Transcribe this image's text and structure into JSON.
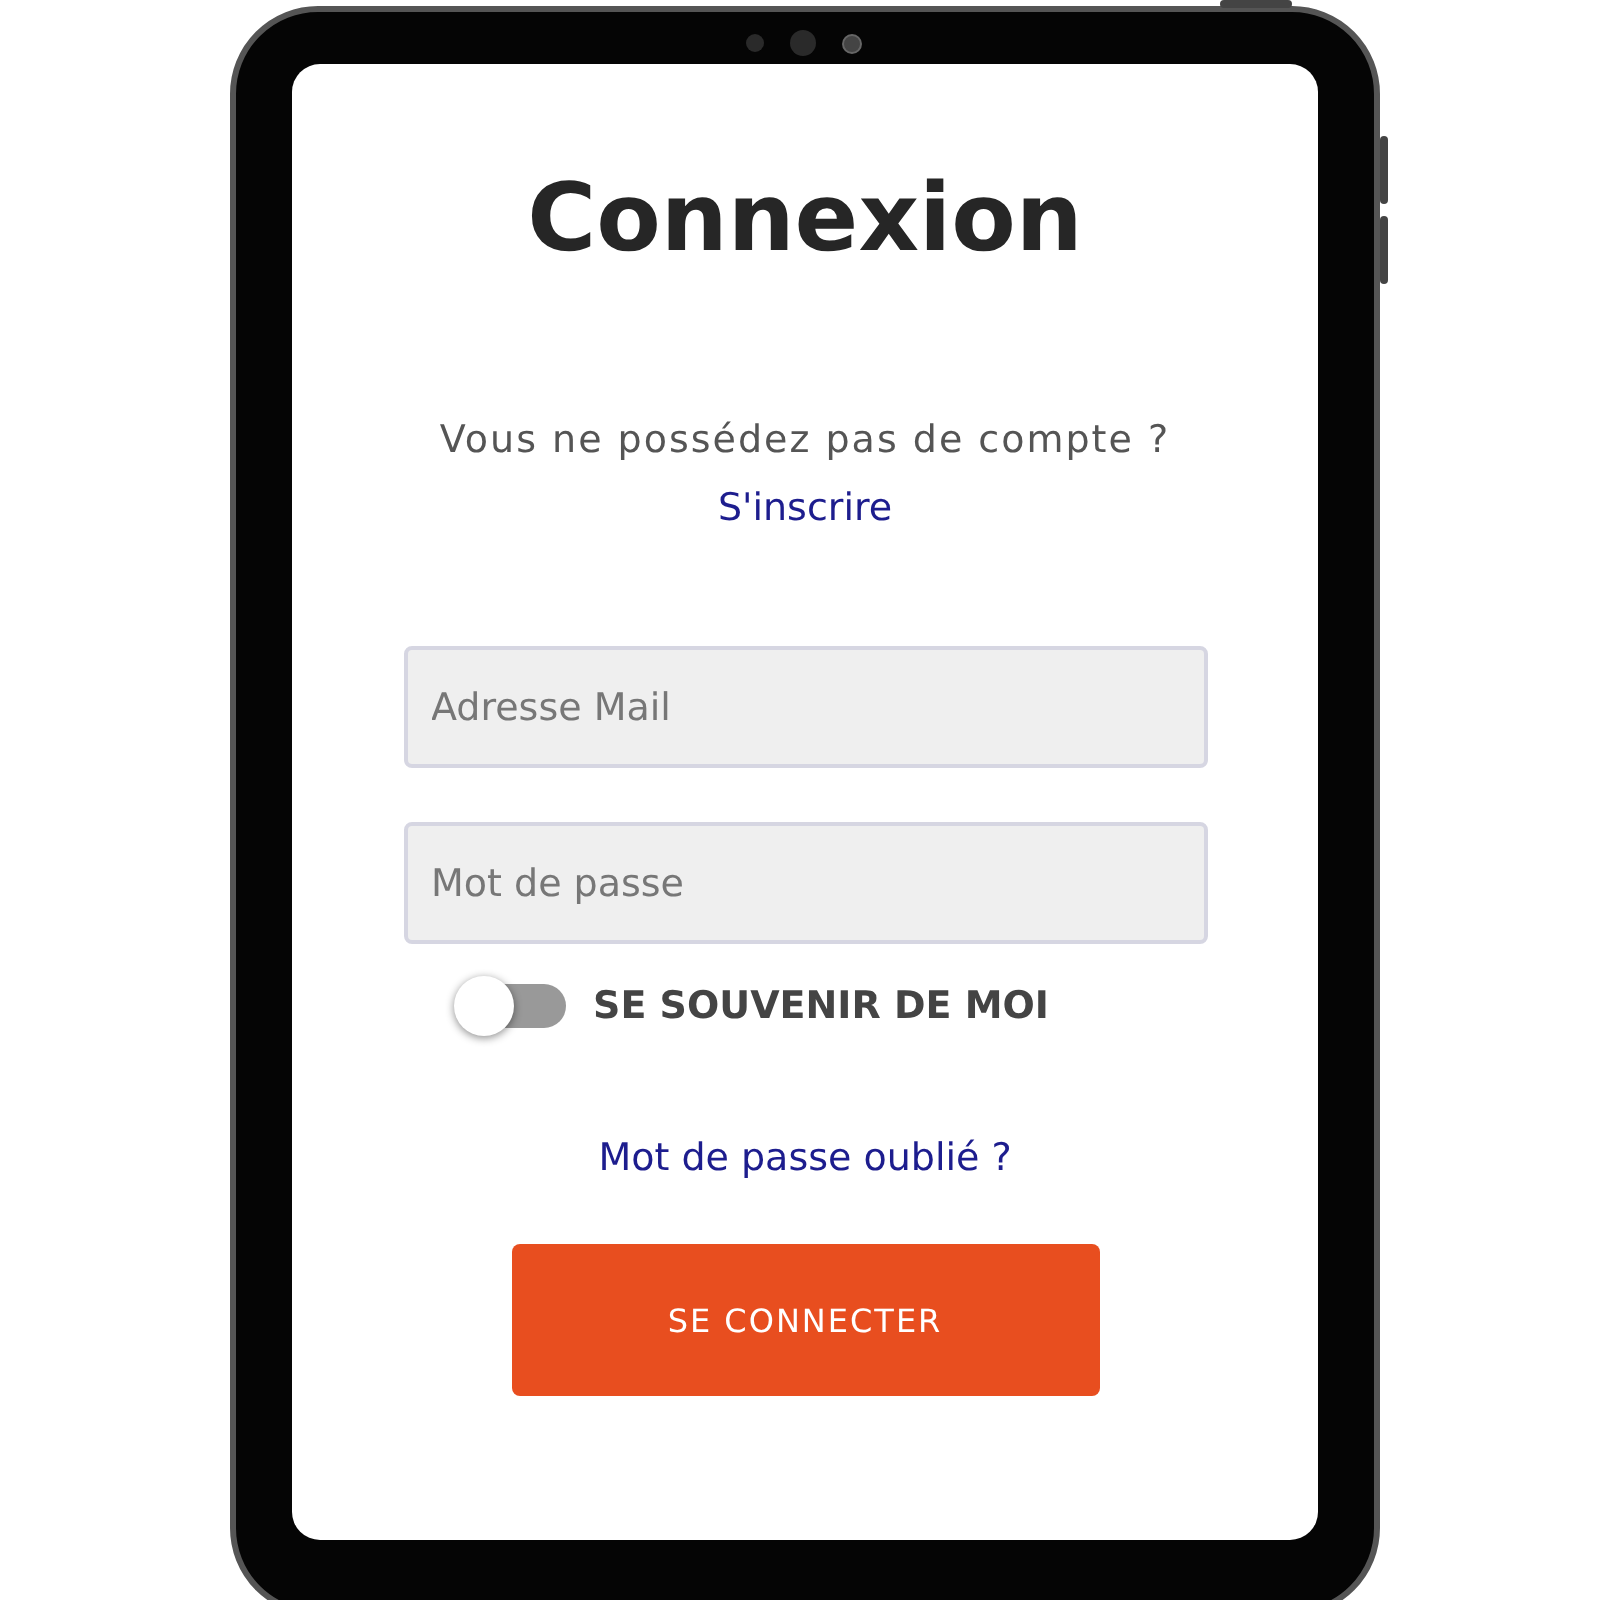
{
  "title": "Connexion",
  "signup_prompt": "Vous ne possédez pas de compte ?",
  "signup_link": "S'inscrire",
  "fields": [
    {
      "placeholder": "Adresse Mail"
    },
    {
      "placeholder": "Mot de passe"
    }
  ],
  "remember_me": {
    "label": "SE SOUVENIR DE MOI",
    "on": false
  },
  "forgot_link": "Mot de passe oublié ?",
  "submit": "SE CONNECTER"
}
